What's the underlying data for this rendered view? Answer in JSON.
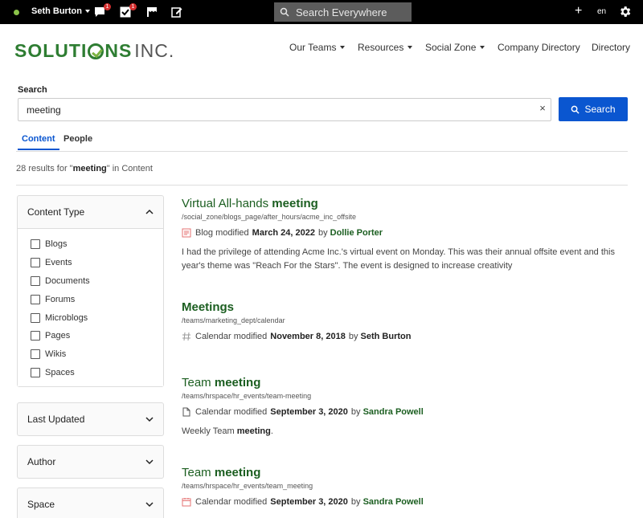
{
  "topbar": {
    "user_name": "Seth Burton",
    "messages_badge": "1",
    "tasks_badge": "1",
    "search_placeholder": "Search Everywhere",
    "plus_label": "+",
    "language": "en",
    "status_color": "#8bc34a"
  },
  "header": {
    "logo_main_prefix": "SOLUTI",
    "logo_main_suffix": "NS",
    "logo_suffix": "INC.",
    "nav": {
      "our_teams": "Our Teams",
      "resources": "Resources",
      "social_zone": "Social Zone",
      "company_directory": "Company Directory",
      "directory": "Directory"
    }
  },
  "search": {
    "label": "Search",
    "value": "meeting",
    "clear_label": "×",
    "button_label": "Search"
  },
  "tabs": {
    "content": "Content",
    "people": "People"
  },
  "results_summary": {
    "count": "28",
    "prefix": "results for \"",
    "query": "meeting",
    "suffix": "\" in Content"
  },
  "filters": {
    "content_type": {
      "title": "Content Type",
      "options": [
        "Blogs",
        "Events",
        "Documents",
        "Forums",
        "Microblogs",
        "Pages",
        "Wikis",
        "Spaces"
      ]
    },
    "last_updated": {
      "title": "Last Updated"
    },
    "author": {
      "title": "Author"
    },
    "space": {
      "title": "Space"
    }
  },
  "results": [
    {
      "title_plain": "Virtual All-hands ",
      "title_bold": "meeting",
      "path": "/social_zone/blogs_page/after_hours/acme_inc_offsite",
      "type": "Blog",
      "modified_label": "modified",
      "date": "March 24, 2022",
      "by_label": "by",
      "author": "Dollie Porter",
      "snippet_plain": "I had the privilege of attending Acme Inc.'s virtual event on Monday. This was their annual offsite event and this year's theme was \"Reach For the Stars\". The event is designed to increase creativity",
      "icon": "blog-icon"
    },
    {
      "title_plain": "",
      "title_bold": "Meetings",
      "path": "/teams/marketing_dept/calendar",
      "type": "Calendar",
      "modified_label": "modified",
      "date": "November 8, 2018",
      "by_label": "by",
      "author": "Seth Burton",
      "icon": "hash-icon"
    },
    {
      "title_plain": "Team ",
      "title_bold": "meeting",
      "path": "/teams/hrspace/hr_events/team-meeting",
      "type": "Calendar",
      "modified_label": "modified",
      "date": "September 3, 2020",
      "by_label": "by",
      "author": "Sandra Powell",
      "snippet_plain": "Weekly Team ",
      "snippet_bold": "meeting",
      "snippet_end": ".",
      "icon": "document-icon"
    },
    {
      "title_plain": "Team ",
      "title_bold": "meeting",
      "path": "/teams/hrspace/hr_events/team_meeting",
      "type": "Calendar",
      "modified_label": "modified",
      "date": "September 3, 2020",
      "by_label": "by",
      "author": "Sandra Powell",
      "icon": "calendar-icon"
    }
  ],
  "colors": {
    "brand_green": "#2e7d32",
    "link_green": "#1b5e20",
    "primary_blue": "#0a56d0",
    "topbar_bg": "#000000"
  }
}
